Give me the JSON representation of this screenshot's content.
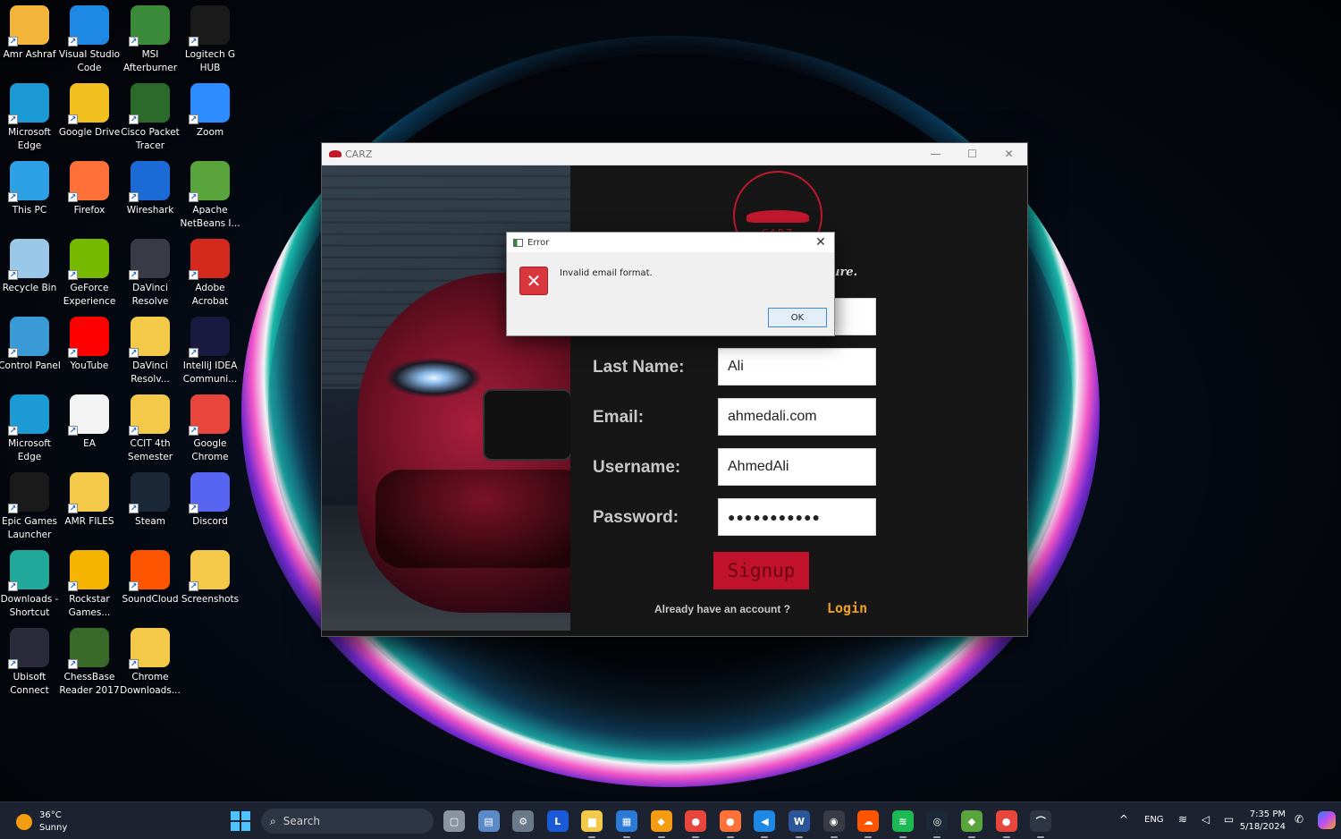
{
  "desktop": {
    "icons": [
      {
        "label": "Amr Ashraf",
        "icon": "user-folder-icon",
        "color": "#f4b63a"
      },
      {
        "label": "Visual Studio\nCode",
        "icon": "vscode-icon",
        "color": "#1e88e5"
      },
      {
        "label": "MSI\nAfterburner",
        "icon": "msi-afterburner-icon",
        "color": "#3a8a3a"
      },
      {
        "label": "Logitech G\nHUB",
        "icon": "logitech-icon",
        "color": "#1a1a1a"
      },
      {
        "label": "Microsoft\nEdge",
        "icon": "edge-icon",
        "color": "#1c9ad6"
      },
      {
        "label": "Google Drive",
        "icon": "google-drive-icon",
        "color": "#f2c01e"
      },
      {
        "label": "Cisco Packet\nTracer",
        "icon": "cisco-icon",
        "color": "#2c6a2c"
      },
      {
        "label": "Zoom",
        "icon": "zoom-icon",
        "color": "#2d8cff"
      },
      {
        "label": "This PC",
        "icon": "this-pc-icon",
        "color": "#2ea0e6"
      },
      {
        "label": "Firefox",
        "icon": "firefox-icon",
        "color": "#ff7139"
      },
      {
        "label": "Wireshark",
        "icon": "wireshark-icon",
        "color": "#1c6ad6"
      },
      {
        "label": "Apache\nNetBeans I...",
        "icon": "netbeans-icon",
        "color": "#5aa43c"
      },
      {
        "label": "Recycle Bin",
        "icon": "recycle-bin-icon",
        "color": "#9ac8e8"
      },
      {
        "label": "GeForce\nExperience",
        "icon": "geforce-icon",
        "color": "#76b900"
      },
      {
        "label": "DaVinci\nResolve",
        "icon": "davinci-icon",
        "color": "#3a3a46"
      },
      {
        "label": "Adobe\nAcrobat",
        "icon": "acrobat-icon",
        "color": "#d42a1e"
      },
      {
        "label": "Control Panel",
        "icon": "control-panel-icon",
        "color": "#3a9ad6"
      },
      {
        "label": "YouTube",
        "icon": "youtube-icon",
        "color": "#ff0000"
      },
      {
        "label": "DaVinci\nResolv...",
        "icon": "folder-icon",
        "color": "#f4c94a"
      },
      {
        "label": "IntelliJ IDEA\nCommuni...",
        "icon": "intellij-icon",
        "color": "#1a1a40"
      },
      {
        "label": "Microsoft\nEdge",
        "icon": "edge-icon",
        "color": "#1c9ad6"
      },
      {
        "label": "EA",
        "icon": "file-icon",
        "color": "#f4f4f4"
      },
      {
        "label": "CCIT 4th\nSemester",
        "icon": "folder-icon",
        "color": "#f4c94a"
      },
      {
        "label": "Google\nChrome",
        "icon": "chrome-icon",
        "color": "#e8453c"
      },
      {
        "label": "Epic Games\nLauncher",
        "icon": "epic-games-icon",
        "color": "#1a1a1a"
      },
      {
        "label": "AMR FILES",
        "icon": "folder-icon",
        "color": "#f4c94a"
      },
      {
        "label": "Steam",
        "icon": "steam-icon",
        "color": "#1b2838"
      },
      {
        "label": "Discord",
        "icon": "discord-icon",
        "color": "#5865f2"
      },
      {
        "label": "Downloads -\nShortcut",
        "icon": "downloads-icon",
        "color": "#20a89a"
      },
      {
        "label": "Rockstar\nGames...",
        "icon": "rockstar-icon",
        "color": "#f4b400"
      },
      {
        "label": "SoundCloud",
        "icon": "soundcloud-icon",
        "color": "#ff5500"
      },
      {
        "label": "Screenshots",
        "icon": "folder-icon",
        "color": "#f4c94a"
      },
      {
        "label": "Ubisoft\nConnect",
        "icon": "ubisoft-icon",
        "color": "#2a2a3a"
      },
      {
        "label": "ChessBase\nReader 2017",
        "icon": "chessbase-icon",
        "color": "#3a6a2a"
      },
      {
        "label": "Chrome\nDownloads...",
        "icon": "folder-icon",
        "color": "#f4c94a"
      }
    ]
  },
  "app": {
    "title": "CARZ",
    "logo_text": "CARZ",
    "subtitle_fragment": "ure.",
    "fields": [
      {
        "label": "Last Name:",
        "value": "Ali"
      },
      {
        "label": "Email:",
        "value": "ahmedali.com"
      },
      {
        "label": "Username:",
        "value": "AhmedAli"
      },
      {
        "label": "Password:",
        "value": "●●●●●●●●●●●"
      }
    ],
    "signup_label": "Signup",
    "already_text": "Already have an account ?",
    "login_label": "Login",
    "accent_color": "#c0122a"
  },
  "dialog": {
    "title": "Error",
    "message": "Invalid email format.",
    "ok_label": "OK",
    "close_symbol": "✕",
    "icon_symbol": "✕"
  },
  "taskbar": {
    "weather_temp": "36°C",
    "weather_desc": "Sunny",
    "search_placeholder": "Search",
    "search_icon": "⌕",
    "apps": [
      {
        "icon": "task-view-icon",
        "color": "#8a93a0",
        "glyph": "▢"
      },
      {
        "icon": "photos-icon",
        "color": "#5a8ac8",
        "glyph": "▤"
      },
      {
        "icon": "settings-icon",
        "color": "#6a7a8a",
        "glyph": "⚙"
      },
      {
        "icon": "l-app-icon",
        "color": "#1a5ad6",
        "glyph": "L"
      },
      {
        "icon": "file-explorer-icon",
        "color": "#f4c94a",
        "glyph": "▆"
      },
      {
        "icon": "store-icon",
        "color": "#2a7ad6",
        "glyph": "▦"
      },
      {
        "icon": "geforce-taskbar-icon",
        "color": "#f39c12",
        "glyph": "◆"
      },
      {
        "icon": "chrome-taskbar-icon",
        "color": "#e8453c",
        "glyph": "●"
      },
      {
        "icon": "firefox-taskbar-icon",
        "color": "#ff7139",
        "glyph": "●"
      },
      {
        "icon": "vscode-taskbar-icon",
        "color": "#1e88e5",
        "glyph": "◀"
      },
      {
        "icon": "word-icon",
        "color": "#2b579a",
        "glyph": "W"
      },
      {
        "icon": "davinci-taskbar-icon",
        "color": "#3a3a46",
        "glyph": "◉"
      },
      {
        "icon": "soundcloud-taskbar-icon",
        "color": "#ff5500",
        "glyph": "☁"
      },
      {
        "icon": "spotify-icon",
        "color": "#1db954",
        "glyph": "≋"
      },
      {
        "icon": "steam-taskbar-icon",
        "color": "#1b2838",
        "glyph": "◎"
      },
      {
        "icon": "netbeans-taskbar-icon",
        "color": "#5aa43c",
        "glyph": "◆"
      },
      {
        "icon": "chrome-profile-icon",
        "color": "#e8453c",
        "glyph": "●"
      },
      {
        "icon": "carz-app-icon",
        "color": "#2e3544",
        "glyph": "⌒"
      }
    ],
    "tray_chevron": "^",
    "language": "ENG",
    "tray_icons": "≋ ◁ ▭",
    "time": "7:35 PM",
    "date": "5/18/2024",
    "notification_icon": "✆"
  }
}
